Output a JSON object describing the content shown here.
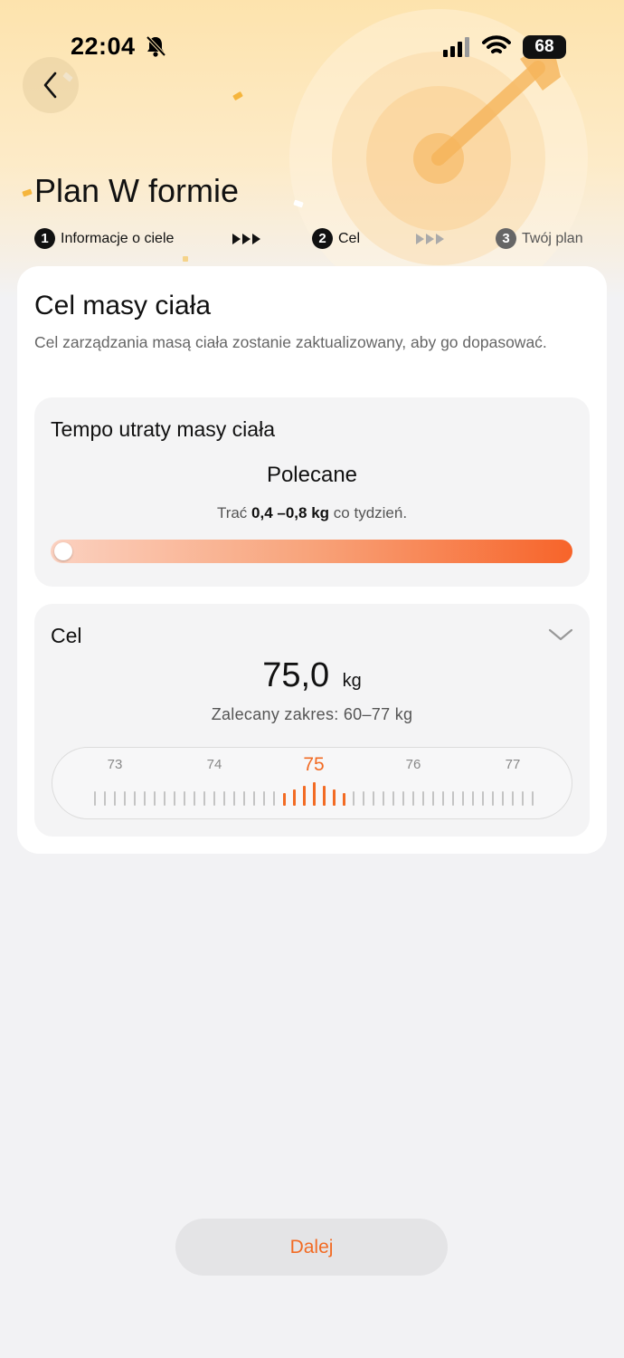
{
  "status_bar": {
    "time": "22:04",
    "battery": "68",
    "icons": [
      "bell-off-icon",
      "signal-icon",
      "wifi-icon",
      "battery-icon"
    ]
  },
  "header": {
    "back_icon": "chevron-left-icon",
    "title": "Plan W formie"
  },
  "steps": [
    {
      "number": "1",
      "label": "Informacje o ciele",
      "active": true
    },
    {
      "number": "2",
      "label": "Cel",
      "active": true
    },
    {
      "number": "3",
      "label": "Twój plan",
      "active": false
    }
  ],
  "card": {
    "title": "Cel masy ciała",
    "subtitle": "Cel zarządzania masą ciała zostanie zaktualizowany, aby go dopasować."
  },
  "tempo": {
    "title": "Tempo utraty masy ciała",
    "recommendation": "Polecane",
    "rate_prefix": "Trać",
    "rate_value": "0,4 –0,8 kg",
    "rate_suffix": "co tydzień.",
    "slider_position": 0.0
  },
  "goal": {
    "title": "Cel",
    "value": "75,0",
    "unit": "kg",
    "range_text": "Zalecany zakres: 60–77 kg",
    "ruler_labels": [
      "73",
      "74",
      "75",
      "76",
      "77"
    ],
    "selected_label": "75"
  },
  "footer": {
    "next_label": "Dalej"
  },
  "colors": {
    "accent": "#f26b24",
    "hero_top": "#fde3ad"
  }
}
